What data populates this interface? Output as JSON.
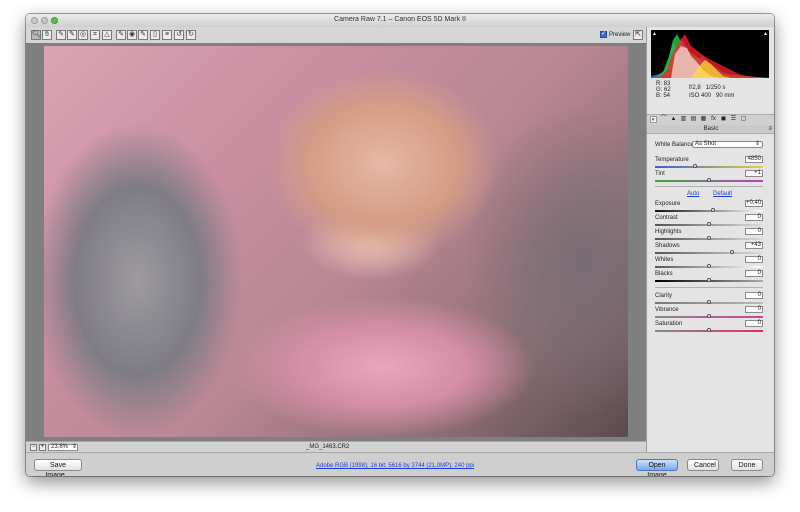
{
  "window": {
    "title": "Camera Raw 7.1  –  Canon EOS 5D Mark II"
  },
  "toolbar": {
    "tools": [
      {
        "name": "zoom-tool",
        "glyph": "🔍︎",
        "active": true
      },
      {
        "name": "hand-tool",
        "glyph": "✋︎"
      },
      {
        "name": "white-balance-tool",
        "glyph": "✎"
      },
      {
        "name": "color-sampler-tool",
        "glyph": "✎"
      },
      {
        "name": "targeted-adjustment-tool",
        "glyph": "◎"
      },
      {
        "name": "crop-tool",
        "glyph": "⌗"
      },
      {
        "name": "straighten-tool",
        "glyph": "△"
      },
      {
        "name": "spot-removal-tool",
        "glyph": "✎"
      },
      {
        "name": "red-eye-tool",
        "glyph": "◉"
      },
      {
        "name": "adjustment-brush-tool",
        "glyph": "✎"
      },
      {
        "name": "graduated-filter-tool",
        "glyph": "▯"
      },
      {
        "name": "preferences-tool",
        "glyph": "≡"
      },
      {
        "name": "rotate-ccw-tool",
        "glyph": "↺"
      },
      {
        "name": "rotate-cw-tool",
        "glyph": "↻"
      }
    ],
    "preview_label": "Preview",
    "preview_checked": true
  },
  "status": {
    "zoom": "23,6%",
    "filename": "_MG_1463.CR2"
  },
  "info": {
    "r_label": "R:",
    "r_value": "83",
    "g_label": "G:",
    "g_value": "62",
    "b_label": "B:",
    "b_value": "54",
    "aperture": "f/2,8",
    "shutter": "1/250 s",
    "iso": "ISO 400",
    "focal": "90 mm"
  },
  "panel": {
    "section_title": "Basic"
  },
  "basic": {
    "white_balance_label": "White Balance:",
    "white_balance_value": "As Shot",
    "auto_label": "Auto",
    "default_label": "Default",
    "sliders": [
      {
        "key": "temperature",
        "label": "Temperature",
        "value": "4850",
        "pos": 0.37,
        "track": "linear-gradient(90deg,#3c5fd0,#e8d040)"
      },
      {
        "key": "tint",
        "label": "Tint",
        "value": "+1",
        "pos": 0.5,
        "track": "linear-gradient(90deg,#3aa640,#c040c0)"
      },
      {
        "key": "exposure",
        "label": "Exposure",
        "value": "+0,40",
        "pos": 0.54,
        "track": "linear-gradient(90deg,#111,#fff)"
      },
      {
        "key": "contrast",
        "label": "Contrast",
        "value": "0",
        "pos": 0.5,
        "track": "linear-gradient(90deg,#555,#ddd)"
      },
      {
        "key": "highlights",
        "label": "Highlights",
        "value": "0",
        "pos": 0.5,
        "track": "linear-gradient(90deg,#555,#ddd)"
      },
      {
        "key": "shadows",
        "label": "Shadows",
        "value": "+43",
        "pos": 0.71,
        "track": "linear-gradient(90deg,#555,#ddd)"
      },
      {
        "key": "whites",
        "label": "Whites",
        "value": "0",
        "pos": 0.5,
        "track": "linear-gradient(90deg,#555,#fff)"
      },
      {
        "key": "blacks",
        "label": "Blacks",
        "value": "0",
        "pos": 0.5,
        "track": "linear-gradient(90deg,#000,#aaa)"
      },
      {
        "key": "clarity",
        "label": "Clarity",
        "value": "0",
        "pos": 0.5,
        "track": "linear-gradient(90deg,#777,#bbb)"
      },
      {
        "key": "vibrance",
        "label": "Vibrance",
        "value": "0",
        "pos": 0.5,
        "track": "linear-gradient(90deg,#888,#d040a0)"
      },
      {
        "key": "saturation",
        "label": "Saturation",
        "value": "0",
        "pos": 0.5,
        "track": "linear-gradient(90deg,#888,#e03060)"
      }
    ]
  },
  "bottom": {
    "save_label": "Save Image...",
    "workflow": "Adobe RGB (1998); 16 bit; 5616 by 3744 (21,0MP); 240 ppi",
    "open_label": "Open Image",
    "cancel_label": "Cancel",
    "done_label": "Done"
  },
  "colors": {
    "accent": "#4a78c6",
    "link": "#1a3fd6"
  }
}
